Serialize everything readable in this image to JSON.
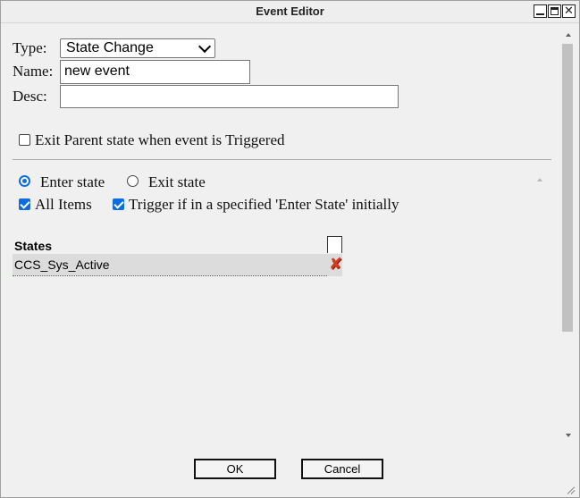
{
  "window": {
    "title": "Event Editor"
  },
  "form": {
    "type_label": "Type:",
    "type_value": "State Change",
    "name_label": "Name:",
    "name_value": "new event",
    "desc_label": "Desc:",
    "desc_value": "",
    "exit_parent_label": "Exit Parent state when event is Triggered",
    "exit_parent_checked": false
  },
  "state_mode": {
    "enter_label": "Enter state",
    "exit_label": "Exit state",
    "selected": "Enter state"
  },
  "options": {
    "all_items_label": "All Items",
    "all_items_checked": true,
    "trigger_label": "Trigger if in a specified 'Enter State' initially",
    "trigger_checked": true
  },
  "states_table": {
    "header": "States",
    "rows": [
      {
        "name": "CCS_Sys_Active"
      }
    ]
  },
  "buttons": {
    "ok_label": "OK",
    "cancel_label": "Cancel"
  },
  "icons": {
    "minimize": "minimize-icon",
    "maximize": "maximize-icon",
    "close": "close-icon",
    "delete_row": "delete-icon",
    "dropdown": "chevron-down-icon"
  },
  "colors": {
    "accent": "#0a6ee0",
    "delete": "#d43a1e",
    "row_focus": "#1d9a1d"
  }
}
